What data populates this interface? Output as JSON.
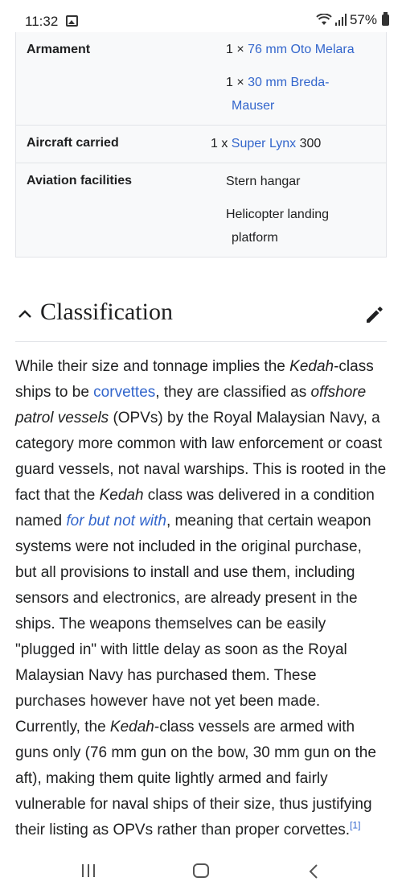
{
  "status": {
    "time": "11:32",
    "battery": "57%"
  },
  "infobox": {
    "armament": {
      "label": "Armament",
      "items": [
        {
          "prefix": "1 × ",
          "link": "76 mm Oto Melara"
        },
        {
          "prefix": "1 × ",
          "link": "30 mm Breda-Mauser",
          "link_line1": "30 mm Breda-",
          "link_line2": "Mauser"
        }
      ]
    },
    "aircraft": {
      "label": "Aircraft carried",
      "prefix": "1 x ",
      "link": "Super Lynx",
      "suffix": " 300"
    },
    "aviation": {
      "label": "Aviation facilities",
      "items": [
        "Stern hangar",
        "Helicopter landing",
        "platform"
      ]
    }
  },
  "section": {
    "title": "Classification"
  },
  "paragraph": {
    "t1": "While their size and tonnage implies the ",
    "i1": "Kedah",
    "t2": "-class ships to be ",
    "link1": "corvettes",
    "t3": ", they are classified as ",
    "i2": "offshore patrol vessels",
    "t4": " (OPVs) by the Royal Malaysian Navy, a category more common with law enforcement or coast guard vessels, not naval warships. This is rooted in the fact that the ",
    "i3": "Kedah",
    "t5": " class was delivered in a condition named ",
    "link2": "for but not with",
    "t6": ", meaning that certain weapon systems were not included in the original purchase, but all provisions to install and use them, including sensors and electronics, are already present in the ships. The weapons themselves can be easily \"plugged in\" with little delay as soon as the Royal Malaysian Navy has purchased them. These purchases however have not yet been made. Currently, the ",
    "i4": "Kedah",
    "t7": "-class vessels are armed with guns only (76 mm gun on the bow, 30 mm gun on the aft), making them quite lightly armed and fairly vulnerable for naval ships of their size, thus justifying their listing as OPVs rather than proper corvettes.",
    "ref": "[1]"
  },
  "colors": {
    "link": "#3366cc",
    "text": "#202122",
    "infobox_bg": "#f8f9fa",
    "border": "#e2e4e8"
  }
}
